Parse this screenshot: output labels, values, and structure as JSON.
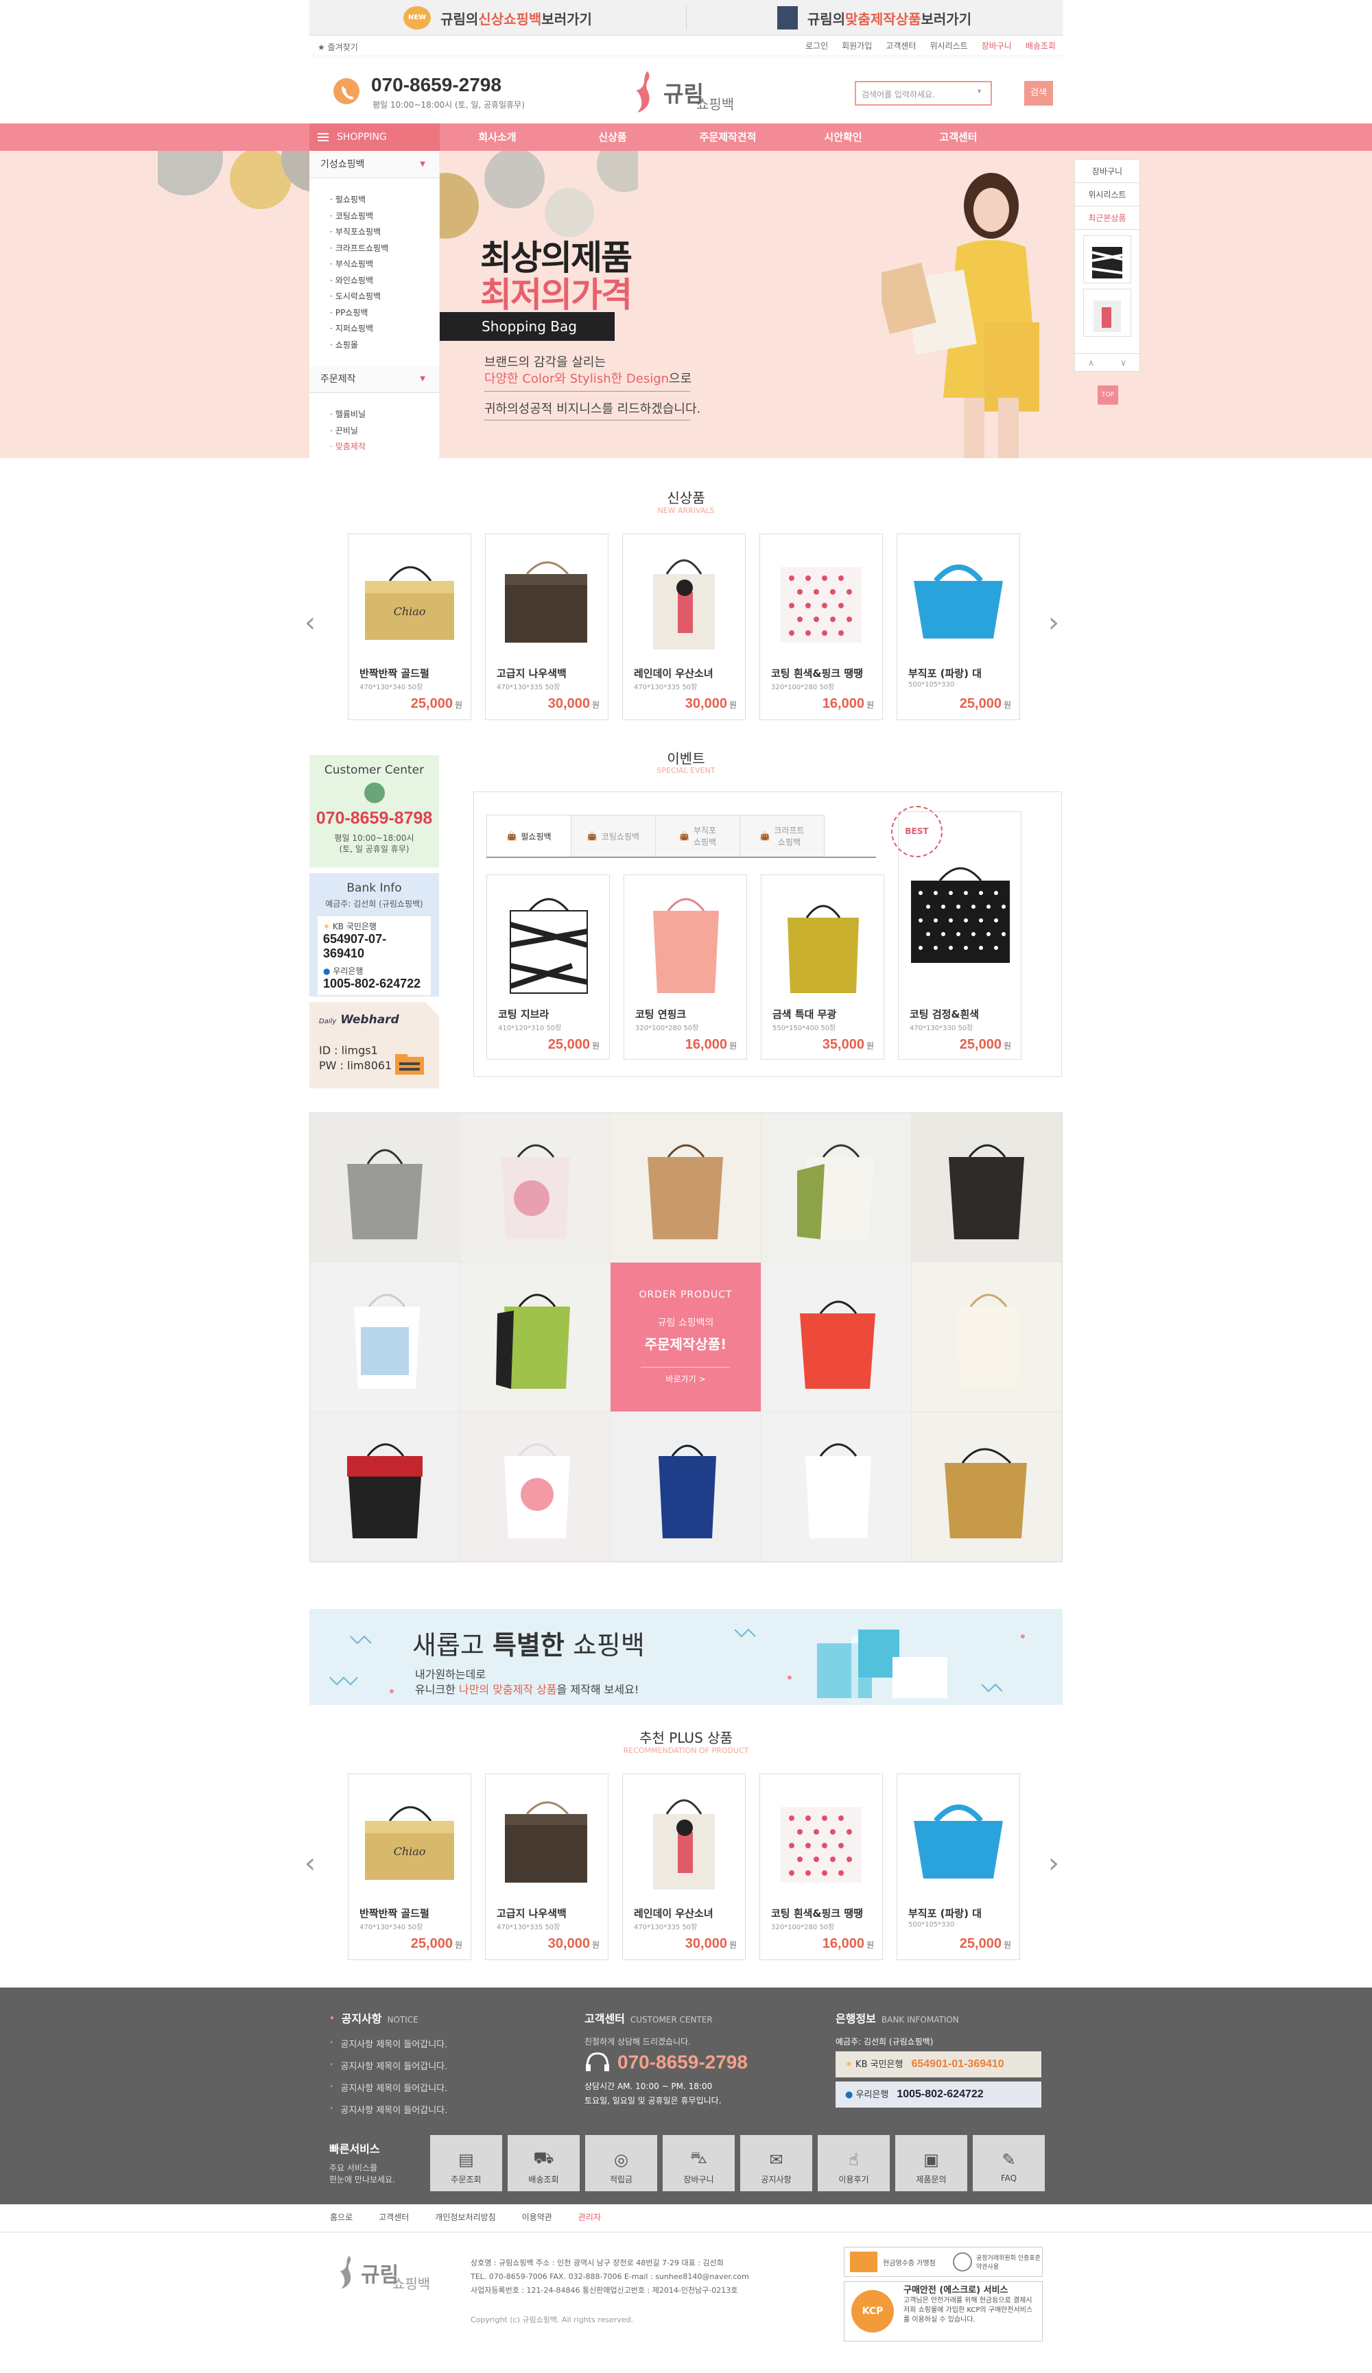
{
  "promo": {
    "left_pre": "규림의 ",
    "left_em": "신상쇼핑백",
    "left_post": " 보러가기",
    "right_pre": "규림의 ",
    "right_em": "맞춤제작상품",
    "right_post": " 보러가기",
    "new_badge": "NEW"
  },
  "util": {
    "bookmark": "즐겨찾기",
    "links": [
      "로그인",
      "회원가입",
      "고객센터",
      "위시리스트"
    ],
    "cart": "장바구니",
    "delivery": "배송조회"
  },
  "header": {
    "phone": "070-8659-2798",
    "hours": "평일 10:00~18:00시 (토, 일, 공휴일휴무)",
    "logo_main": "규림",
    "logo_sub": "쇼핑백",
    "search_placeholder": "검색어를 입력하세요.",
    "search_button": "검색"
  },
  "nav": {
    "category": "SHOPPING CATEGORY",
    "items": [
      "회사소개",
      "신상품",
      "주문제작견적",
      "시안확인",
      "고객센터"
    ]
  },
  "category": {
    "group1": "기성쇼핑백",
    "items1": [
      "펄쇼핑백",
      "코팅쇼핑백",
      "부직포쇼핑백",
      "크라프트쇼핑백",
      "부식쇼핑백",
      "와인쇼핑백",
      "도시락쇼핑백",
      "PP쇼핑백",
      "지퍼쇼핑백",
      "쇼핑몰"
    ],
    "group2": "주문제작",
    "items2": [
      "헬륨비닐",
      "끈비닐",
      "맞춤제작"
    ]
  },
  "hero": {
    "line1": "최상의제품",
    "line2": "최저의가격",
    "tag": "Shopping Bag",
    "p1": "브랜드의 감각을 살리는",
    "p2_em": "다양한 Color와 Stylish한 Design",
    "p2_post": "으로",
    "p3": "귀하의성공적 비지니스를 리드하겠습니다."
  },
  "quick": {
    "items": [
      "장바구니",
      "위시리스트",
      "최근본상품"
    ],
    "up": "∧",
    "down": "∨",
    "top": "TOP"
  },
  "new_arrivals": {
    "title": "신상품",
    "subtitle": "NEW ARRIVALS",
    "products": [
      {
        "name": "반짝반짝 골드펄",
        "size": "470*130*340 50장",
        "price": "25,000",
        "unit": "원"
      },
      {
        "name": "고급지 나우색백",
        "size": "470*130*335 50장",
        "price": "30,000",
        "unit": "원"
      },
      {
        "name": "레인데이 우산소녀",
        "size": "470*130*335 50장",
        "price": "30,000",
        "unit": "원"
      },
      {
        "name": "코팅 흰색&핑크 땡땡",
        "size": "320*100*280 50장",
        "price": "16,000",
        "unit": "원"
      },
      {
        "name": "부직포 (파랑) 대",
        "size": "500*105*330",
        "price": "25,000",
        "unit": "원"
      }
    ]
  },
  "cs": {
    "title": "Customer Center",
    "phone": "070-8659-8798",
    "hours1": "평일 10:00~18:00시",
    "hours2": "(토, 일 공휴일 휴무)",
    "bank_title": "Bank Info",
    "holder": "예금주: 김선희 (규림쇼핑백)",
    "bank1": "KB 국민은행",
    "acc1": "654907-07-369410",
    "bank2": "우리은행",
    "acc2": "1005-802-624722",
    "webhard": "Webhard",
    "webhard_pre": "Daily",
    "id": "ID : limgs1",
    "pw": "PW : lim8061"
  },
  "event": {
    "title": "이벤트",
    "subtitle": "SPECIAL EVENT",
    "tabs": [
      "펄쇼핑백",
      "코팅쇼핑백",
      "부직포\n쇼핑백",
      "크라프트\n쇼핑백"
    ],
    "best": "BEST",
    "products": [
      {
        "name": "코팅 지브라",
        "size": "410*120*310 50장",
        "price": "25,000",
        "unit": "원"
      },
      {
        "name": "코팅 연핑크",
        "size": "320*100*280 50장",
        "price": "16,000",
        "unit": "원"
      },
      {
        "name": "금색 특대 무광",
        "size": "550*150*400 50장",
        "price": "35,000",
        "unit": "원"
      },
      {
        "name": "코팅 검정&흰색",
        "size": "470*130*330 50장",
        "price": "25,000",
        "unit": "원"
      }
    ]
  },
  "order": {
    "title": "ORDER PRODUCT",
    "line1": "규림 쇼핑백의",
    "line2": "주문제작상품!",
    "link": "바로가기  >"
  },
  "banner": {
    "pre": "새롭고 ",
    "bold": "특별한",
    "post": " 쇼핑백",
    "l1": "내가원하는데로",
    "l2_pre": "유니크한 ",
    "l2_em": "나만의 맞춤제작 상품",
    "l2_post": "을 제작해 보세요!"
  },
  "recommend": {
    "title": "추천 PLUS 상품",
    "subtitle": "RECOMMENDATION OF PRODUCT",
    "products": [
      {
        "name": "반짝반짝 골드펄",
        "size": "470*130*340 50장",
        "price": "25,000",
        "unit": "원"
      },
      {
        "name": "고급지 나우색백",
        "size": "470*130*335 50장",
        "price": "30,000",
        "unit": "원"
      },
      {
        "name": "레인데이 우산소녀",
        "size": "470*130*335 50장",
        "price": "30,000",
        "unit": "원"
      },
      {
        "name": "코팅 흰색&핑크 땡땡",
        "size": "320*100*280 50장",
        "price": "16,000",
        "unit": "원"
      },
      {
        "name": "부직포 (파랑) 대",
        "size": "500*105*330",
        "price": "25,000",
        "unit": "원"
      }
    ]
  },
  "footer": {
    "notice_title": "공지사항",
    "notice_sub": "NOTICE",
    "notices": [
      "공지사항 제목이 들어갑니다.",
      "공지사항 제목이 들어갑니다.",
      "공지사항 제목이 들어갑니다.",
      "공지사항 제목이 들어갑니다."
    ],
    "cc_title": "고객센터",
    "cc_sub": "CUSTOMER CENTER",
    "cc_line": "친절하게 상담해 드리겠습니다.",
    "cc_phone": "070-8659-2798",
    "cc_h1": "상담시간  AM. 10:00 ~ PM. 18:00",
    "cc_h2": "토요일, 일요일 및 공휴일은 휴무입니다.",
    "bank_title": "은행정보",
    "bank_sub": "BANK INFOMATION",
    "bank_holder": "예금주: 김선희 (규림쇼핑백)",
    "bank1": "KB 국민은행",
    "acc1": "654901-01-369410",
    "bank2": "우리은행",
    "acc2": "1005-802-624722",
    "quick_title": "빠른서비스",
    "quick_desc1": "주요 서비스를",
    "quick_desc2": "한눈에 만나보세요.",
    "services": [
      "주문조회",
      "배송조회",
      "적립금",
      "장바구니",
      "공지사항",
      "이용후기",
      "제품문의",
      "FAQ"
    ],
    "links": [
      "홈으로",
      "고객센터",
      "개인정보처리방침",
      "이용약관",
      "관리자"
    ],
    "logo_main": "규림",
    "logo_sub": "쇼핑백",
    "info1": "상호명 : 규림쇼핑백     주소 : 인천 광역시 남구 장천로 48번길 7-29     대표 : 김선희",
    "info2": "TEL. 070-8659-7006     FAX. 032-888-7006     E-mail : sunhee8140@naver.com",
    "info3": "사업자등록번호 : 121-24-84846     통신판매업신고번호 : 제2014-인천남구-0213호",
    "copy": "Copyright (c) 규림쇼핑백. All rights reserved.",
    "cert1": "현금영수증 가맹점",
    "cert2": "공정거래위원회 인증표준약관사용",
    "kcp_title": "구매안전 (에스크로) 서비스",
    "kcp_desc": "고객님은 안전거래를 위해 현금등으로 결제시 저희 쇼핑몰에 가입한 KCP의 구매안전서비스를 이용하실 수 있습니다.",
    "kcp_badge": "KCP"
  },
  "colors": {
    "accent": "#f28b95",
    "price": "#e8604c",
    "footer": "#616161"
  }
}
